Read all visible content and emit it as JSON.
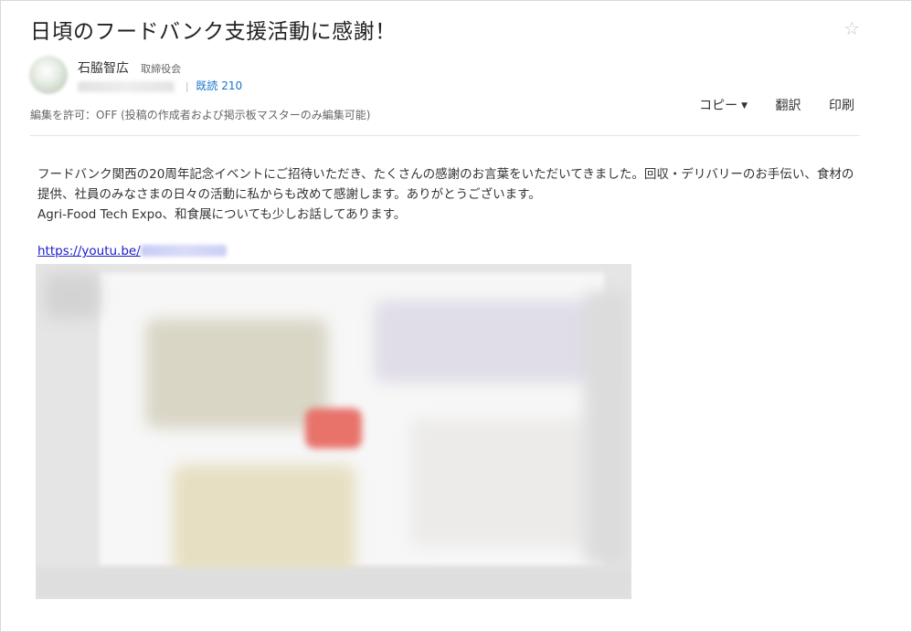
{
  "post": {
    "title": "日頃のフードバンク支援活動に感謝！",
    "author_name": "石脇智広",
    "author_role": "取締役会",
    "read_label": "既読 210",
    "edit_permission": "編集を許可：OFF (投稿の作成者および掲示板マスターのみ編集可能)"
  },
  "actions": {
    "copy_label": "コピー",
    "translate_label": "翻訳",
    "print_label": "印刷"
  },
  "body": {
    "paragraph_1": "フードバンク関西の20周年記念イベントにご招待いただき、たくさんの感謝のお言葉をいただいてきました。回収・デリバリーのお手伝い、食材の提供、社員のみなさまの日々の活動に私からも改めて感謝します。ありがとうございます。",
    "paragraph_2": "Agri-Food Tech Expo、和食展についても少しお話してあります。",
    "link_prefix": "https://youtu.be/"
  },
  "icons": {
    "star": "star-outline-icon",
    "caret": "caret-down-icon"
  },
  "colors": {
    "link": "#1a1acc",
    "read_count": "#1a73c9"
  }
}
